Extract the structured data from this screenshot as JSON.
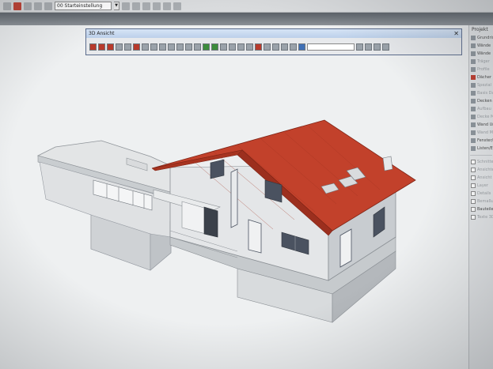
{
  "toolbar": {
    "view_combo_value": "00 Starteinstellung"
  },
  "window": {
    "title": "3D Ansicht",
    "close_glyph": "✕"
  },
  "panel": {
    "header": "Projekt",
    "items": [
      {
        "label": "Grundriss",
        "icon": "page-icon",
        "dim": false
      },
      {
        "label": "Wände",
        "icon": "wall-icon",
        "dim": false
      },
      {
        "label": "Wände",
        "icon": "wall-icon",
        "dim": false
      },
      {
        "label": "Träger",
        "icon": "beam-icon",
        "dim": true
      },
      {
        "label": "Profile",
        "icon": "profile-icon",
        "dim": true
      },
      {
        "label": "Dächer",
        "icon": "roof-icon",
        "dim": false
      },
      {
        "label": "Spezial",
        "icon": "special-icon",
        "dim": true
      },
      {
        "label": "Basis Da.",
        "icon": "base-icon",
        "dim": true
      },
      {
        "label": "Decken",
        "icon": "slab-icon",
        "dim": false
      },
      {
        "label": "Aufbau",
        "icon": "layer-icon",
        "dim": true
      },
      {
        "label": "Decke Ma.",
        "icon": "slab-icon",
        "dim": true
      },
      {
        "label": "Wand Un.",
        "icon": "wall-icon",
        "dim": false
      },
      {
        "label": "Wand Ma.",
        "icon": "wall-icon",
        "dim": true
      },
      {
        "label": "Fenster/T.",
        "icon": "window-icon",
        "dim": false
      },
      {
        "label": "Listen/Ern.",
        "icon": "list-icon",
        "dim": false
      }
    ],
    "lower_items": [
      {
        "label": "Schnitte",
        "dim": true
      },
      {
        "label": "Ansichten",
        "dim": true
      },
      {
        "label": "Ansicht",
        "dim": true
      },
      {
        "label": "Layer",
        "dim": true
      },
      {
        "label": "Details",
        "dim": true
      },
      {
        "label": "Bemaßung",
        "dim": true
      },
      {
        "label": "Bauteile",
        "dim": false
      },
      {
        "label": "Texte 3D",
        "dim": true
      }
    ]
  },
  "colors": {
    "roof": "#c2412b",
    "roof_dark": "#9c2f1e",
    "wall_light": "#e9ebec",
    "wall_mid": "#d3d6d8",
    "wall_dark": "#b9bdc0",
    "window": "#4a5260",
    "title_bar": "#c6d8ef"
  }
}
